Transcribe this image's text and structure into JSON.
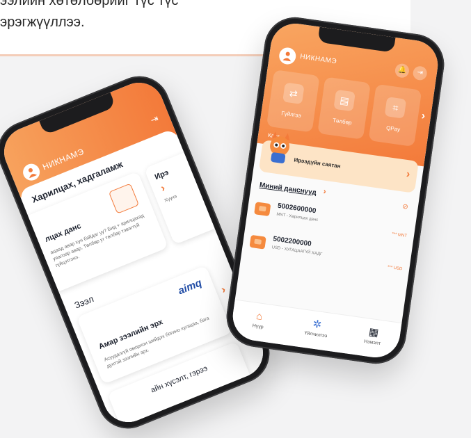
{
  "banner": {
    "line1": "ээлийн хөтөлбөрийг түс түс",
    "line2": "эрэгжүүллээ."
  },
  "left_phone": {
    "nickname": "НИКНАМЭ",
    "section1": "Харилцах, хадгаламж",
    "card1_title": "лцах данс",
    "card1_text": "ацаад авар хун байдаг уу? Бид + арилцахад уяалзар авар. Төлбөр уг төлбөр тэвэгтүй гүйцэтгэнэ.",
    "card2_title": "Ирэ",
    "card2_text": "Хүүхэ",
    "section2": "Зээл",
    "loan_title": "Амар зээлийн эрх",
    "loan_brand": "aimq",
    "loan_text": "Асуудалгүй оморхон шийдэх богино хугацаа, бага дүнтэй зээлийн эрх.",
    "bottom_text": "айн хүсэлт, гэрээ"
  },
  "right_phone": {
    "nickname": "НИКНАМЭ",
    "tiles": [
      {
        "label": "Гүйлгээ",
        "icon": "transfer-icon"
      },
      {
        "label": "Төлбөр",
        "icon": "bill-icon"
      },
      {
        "label": "QPay",
        "icon": "qr-icon"
      }
    ],
    "card_label": "Карт",
    "promo_text": "Ирээдүйн саятан",
    "accounts_title": "Миний данснууд",
    "accounts": [
      {
        "number": "5002600000",
        "sub": "MNT - Харилцах данс",
        "balance": "*** MNT"
      },
      {
        "number": "5002200000",
        "sub": "USD - ХУГАЦААГҮЙ ХАДГ",
        "balance": "*** USD"
      }
    ],
    "tabs": [
      {
        "label": "Нүүр",
        "icon": "home-icon"
      },
      {
        "label": "Үйлчилгээ",
        "icon": "services-icon"
      },
      {
        "label": "Нэмэлт",
        "icon": "more-icon"
      }
    ],
    "colors": {
      "accent": "#f37a3a",
      "accent_light": "#f9a661"
    }
  }
}
